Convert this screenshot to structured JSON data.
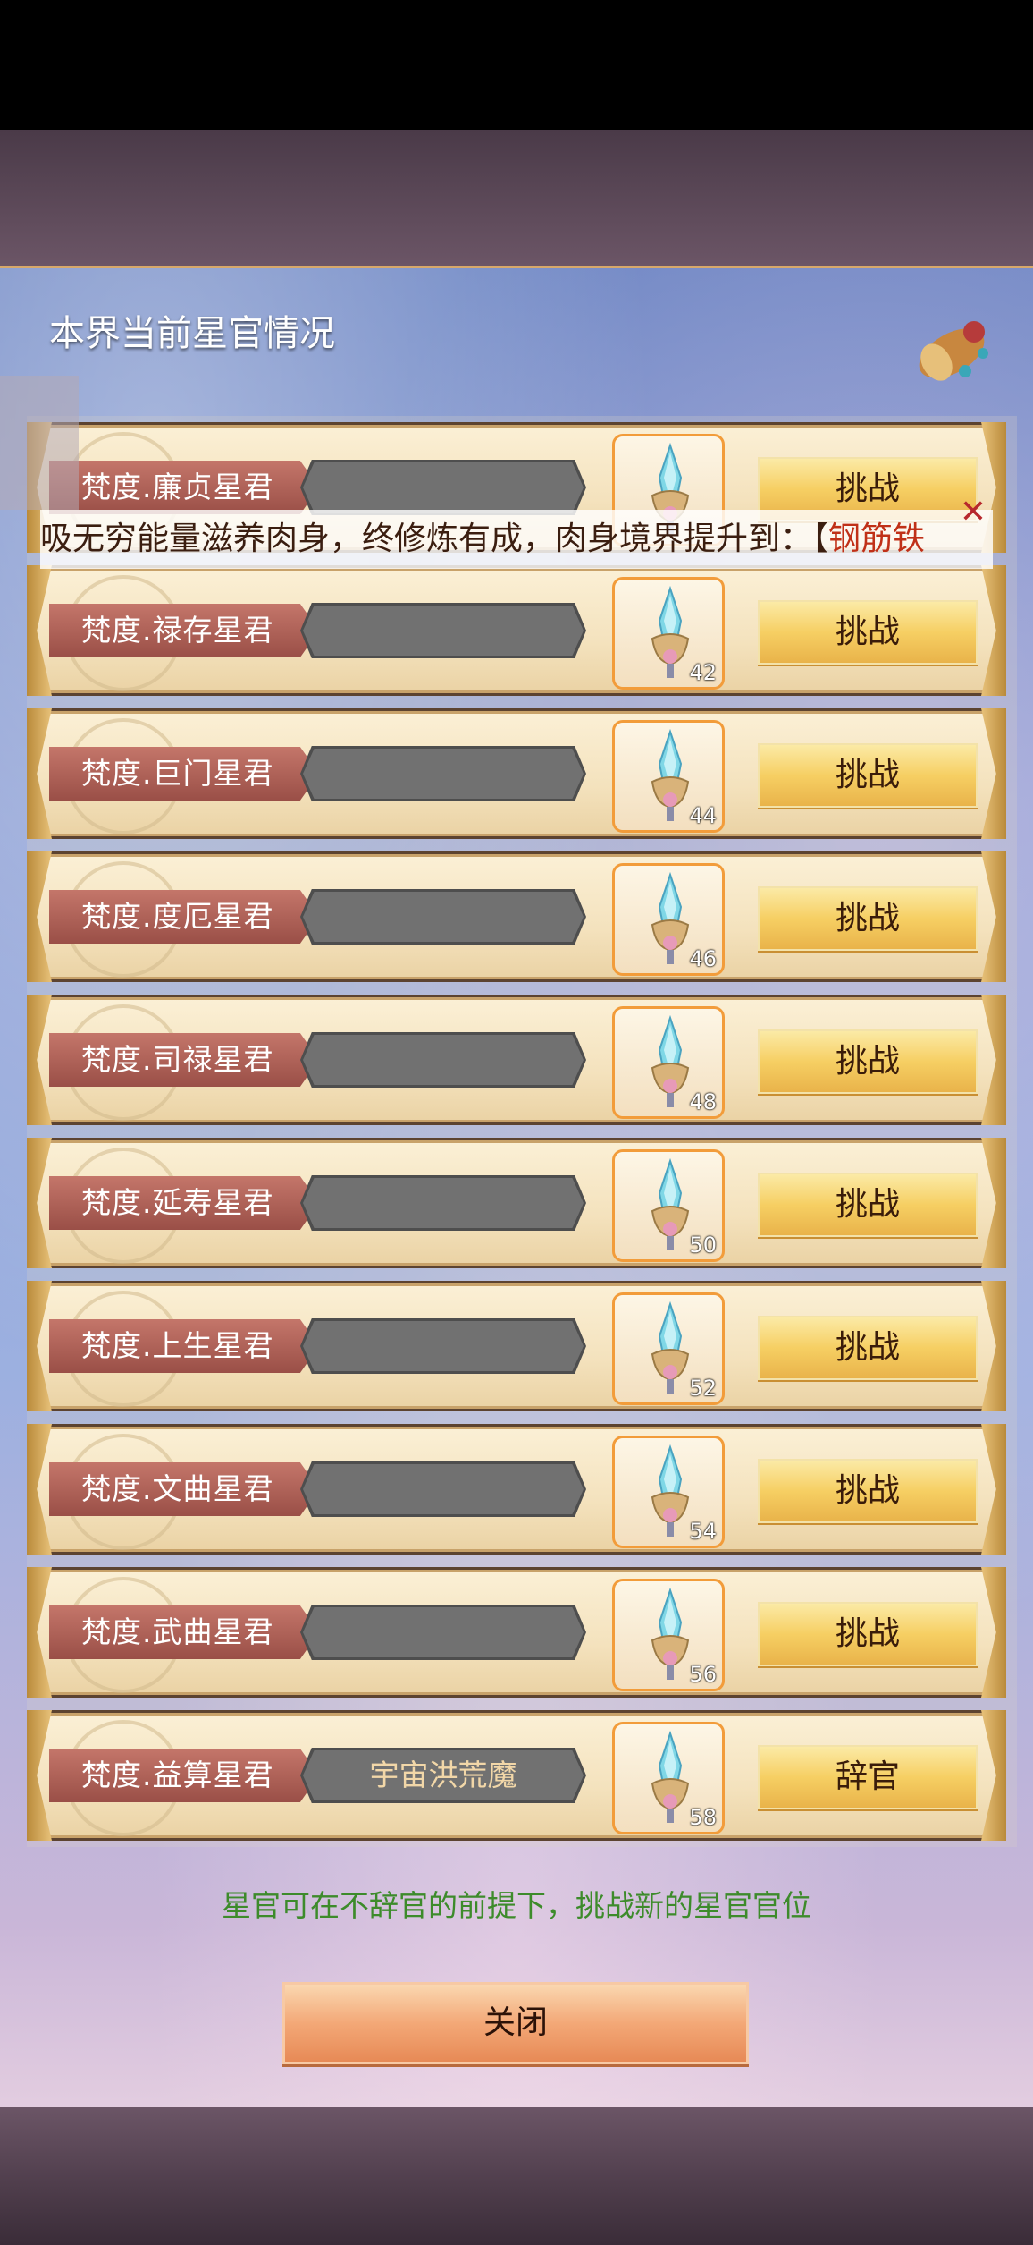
{
  "panel": {
    "title": "本界当前星官情况"
  },
  "notice": {
    "text": "吸无穷能量滋养肉身，终修炼有成，肉身境界提升到：【",
    "highlight": "钢筋铁"
  },
  "rows": [
    {
      "name": "梵度.廉贞星君",
      "occupant": "",
      "level": "",
      "action": "挑战"
    },
    {
      "name": "梵度.禄存星君",
      "occupant": "",
      "level": "42",
      "action": "挑战"
    },
    {
      "name": "梵度.巨门星君",
      "occupant": "",
      "level": "44",
      "action": "挑战"
    },
    {
      "name": "梵度.度厄星君",
      "occupant": "",
      "level": "46",
      "action": "挑战"
    },
    {
      "name": "梵度.司禄星君",
      "occupant": "",
      "level": "48",
      "action": "挑战"
    },
    {
      "name": "梵度.延寿星君",
      "occupant": "",
      "level": "50",
      "action": "挑战"
    },
    {
      "name": "梵度.上生星君",
      "occupant": "",
      "level": "52",
      "action": "挑战"
    },
    {
      "name": "梵度.文曲星君",
      "occupant": "",
      "level": "54",
      "action": "挑战"
    },
    {
      "name": "梵度.武曲星君",
      "occupant": "",
      "level": "56",
      "action": "挑战"
    },
    {
      "name": "梵度.益算星君",
      "occupant": "宇宙洪荒魔",
      "level": "58",
      "action": "辞官"
    }
  ],
  "hint": "星官可在不辞官的前提下，挑战新的星官官位",
  "close_button": "关闭",
  "colors": {
    "hint": "#3d8b2b",
    "accent_btn": "#f6cf63",
    "name_tag": "#b0625a"
  }
}
